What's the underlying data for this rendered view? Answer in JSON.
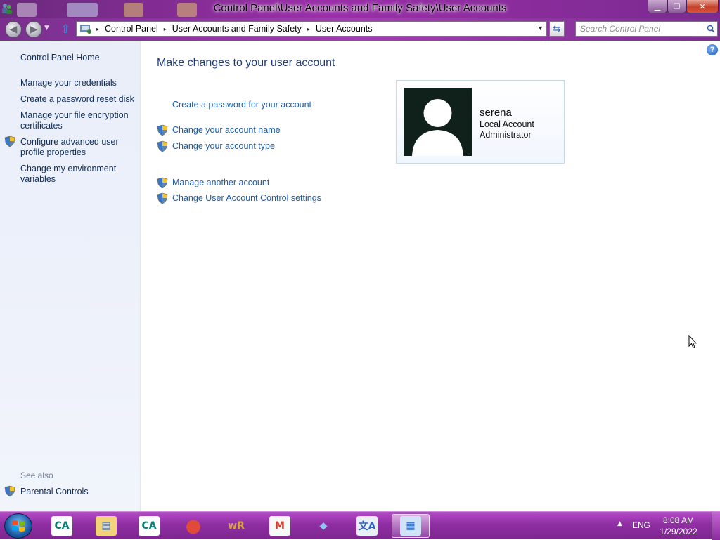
{
  "window": {
    "title": "Control Panel\\User Accounts and Family Safety\\User Accounts",
    "minimize_glyph": "▁",
    "maximize_glyph": "❐",
    "close_glyph": "✕"
  },
  "nav": {
    "back_glyph": "◀",
    "forward_glyph": "▶",
    "recent_glyph": "▼",
    "up_glyph": "⇧",
    "breadcrumbs": [
      "Control Panel",
      "User Accounts and Family Safety",
      "User Accounts"
    ],
    "crumb_separator": "▸",
    "dropdown_glyph": "▼",
    "refresh_glyph": "⇆",
    "search_placeholder": "Search Control Panel"
  },
  "sidebar": {
    "home_label": "Control Panel Home",
    "items": [
      {
        "label": "Manage your credentials",
        "shield": false
      },
      {
        "label": "Create a password reset disk",
        "shield": false
      },
      {
        "label": "Manage your file encryption certificates",
        "shield": false
      },
      {
        "label": "Configure advanced user profile properties",
        "shield": true
      },
      {
        "label": "Change my environment variables",
        "shield": false
      }
    ],
    "see_also_label": "See also",
    "see_also_items": [
      {
        "label": "Parental Controls",
        "shield": true
      }
    ]
  },
  "main": {
    "title": "Make changes to your user account",
    "help_glyph": "?",
    "tasks": [
      {
        "label": "Create a password for your account",
        "shield": false
      },
      {
        "label": "Change your account name",
        "shield": true
      },
      {
        "label": "Change your account type",
        "shield": true
      },
      {
        "label": "Manage another account",
        "shield": true
      },
      {
        "label": "Change User Account Control settings",
        "shield": true
      }
    ],
    "account": {
      "name": "serena",
      "type": "Local Account",
      "role": "Administrator"
    }
  },
  "taskbar": {
    "apps": [
      {
        "name": "credit-agricole-icon",
        "glyph": "CA",
        "bg": "#ffffff",
        "fg": "#0a7c73"
      },
      {
        "name": "file-explorer-icon",
        "glyph": "▤",
        "bg": "#f2d27a",
        "fg": "#5b7fb0"
      },
      {
        "name": "credit-agricole-icon-2",
        "glyph": "CA",
        "bg": "#ffffff",
        "fg": "#0a7c73"
      },
      {
        "name": "chrome-icon",
        "glyph": "●",
        "bg": "transparent",
        "fg": "#e04a3a"
      },
      {
        "name": "winrar-icon",
        "glyph": "wR",
        "bg": "transparent",
        "fg": "#d8a43a"
      },
      {
        "name": "gmail-icon",
        "glyph": "M",
        "bg": "#f7f7f7",
        "fg": "#d93a2b"
      },
      {
        "name": "folder-icon",
        "glyph": "◆",
        "bg": "transparent",
        "fg": "#8cc8f0"
      },
      {
        "name": "translate-icon",
        "glyph": "文A",
        "bg": "#e9eef7",
        "fg": "#2b63c0"
      },
      {
        "name": "control-panel-icon",
        "glyph": "▦",
        "bg": "#cfe2f6",
        "fg": "#2a6bc4"
      }
    ],
    "tray_glyph": "▲",
    "language": "ENG",
    "time": "8:08 AM",
    "date": "1/29/2022"
  }
}
